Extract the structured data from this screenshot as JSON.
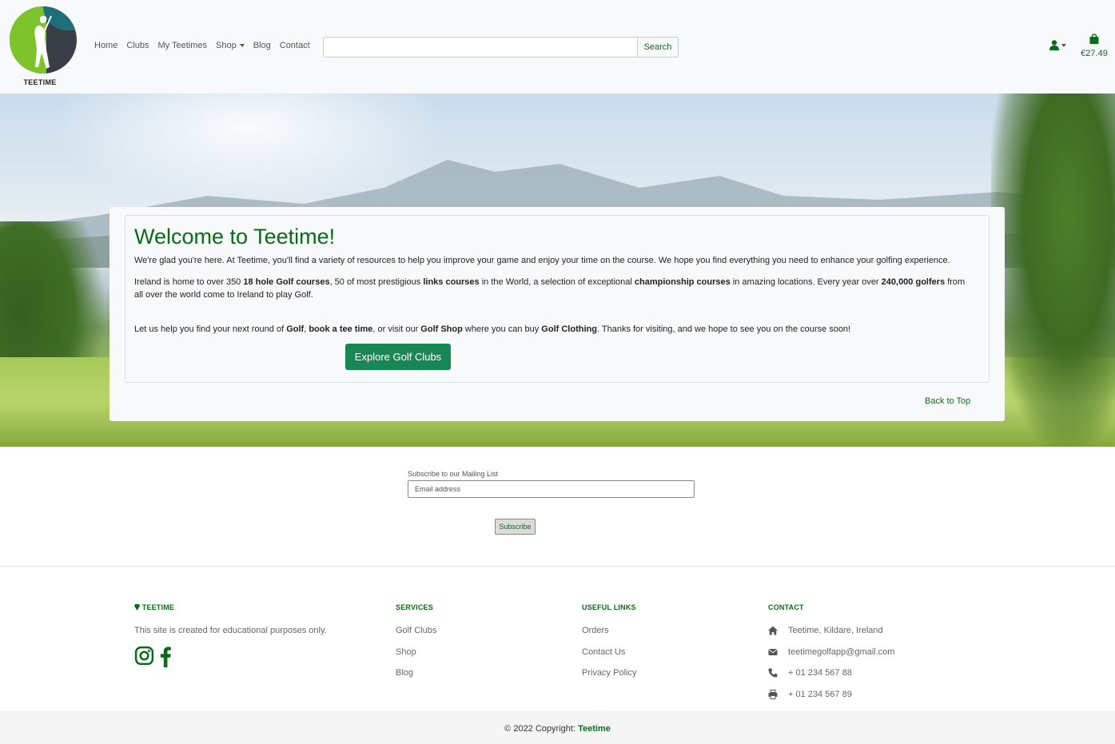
{
  "brand": {
    "logo_text": "TEETIME"
  },
  "nav": {
    "links": [
      "Home",
      "Clubs",
      "My Teetimes",
      "Shop",
      "Blog",
      "Contact"
    ],
    "search_button": "Search",
    "search_placeholder": "",
    "cart_total": "€27.49"
  },
  "hero": {
    "title": "Welcome to Teetime!",
    "p1": "We're glad you're here. At Teetime, you'll find a variety of resources to help you improve your game and enjoy your time on the course. We hope you find everything you need to enhance your golfing experience.",
    "p2": {
      "t1": "Ireland is home to over 350 ",
      "b1": "18 hole Golf courses",
      "t2": ", 50 of most prestigious ",
      "b2": "links courses",
      "t3": " in the World, a selection of exceptional ",
      "b3": "championship courses",
      "t4": " in amazing locations. Every year over ",
      "b4": "240,000 golfers",
      "t5": " from all over the world come to Ireland to play Golf."
    },
    "p3": {
      "t1": "Let us help you find your next round of ",
      "b1": "Golf",
      "t2": ", ",
      "b2": "book a tee time",
      "t3": ", or visit our ",
      "b3": "Golf Shop",
      "t4": " where you can buy ",
      "b4": "Golf Clothing",
      "t5": ". Thanks for visiting, and we hope to see you on the course soon!"
    },
    "button": "Explore Golf Clubs",
    "back_to_top": "Back to Top"
  },
  "subscribe": {
    "label": "Subscribe to our Mailing List",
    "placeholder": "Email address",
    "button": "Subscribe"
  },
  "footer": {
    "brand_heading": "TEETIME",
    "brand_text": "This site is created for educational purposes only.",
    "services_heading": "SERVICES",
    "services": [
      "Golf Clubs",
      "Shop",
      "Blog"
    ],
    "links_heading": "USEFUL LINKS",
    "links": [
      "Orders",
      "Contact Us",
      "Privacy Policy"
    ],
    "contact_heading": "CONTACT",
    "address": "Teetime, Kildare, Ireland",
    "email": "teetimegolfapp@gmail.com",
    "phone": "+ 01 234 567 88",
    "fax": "+ 01 234 567 89",
    "copyright_prefix": "© 2022 Copyright: ",
    "copyright_brand": "Teetime"
  },
  "colors": {
    "brand_green": "#0b6b1b",
    "button_green": "#198754"
  }
}
